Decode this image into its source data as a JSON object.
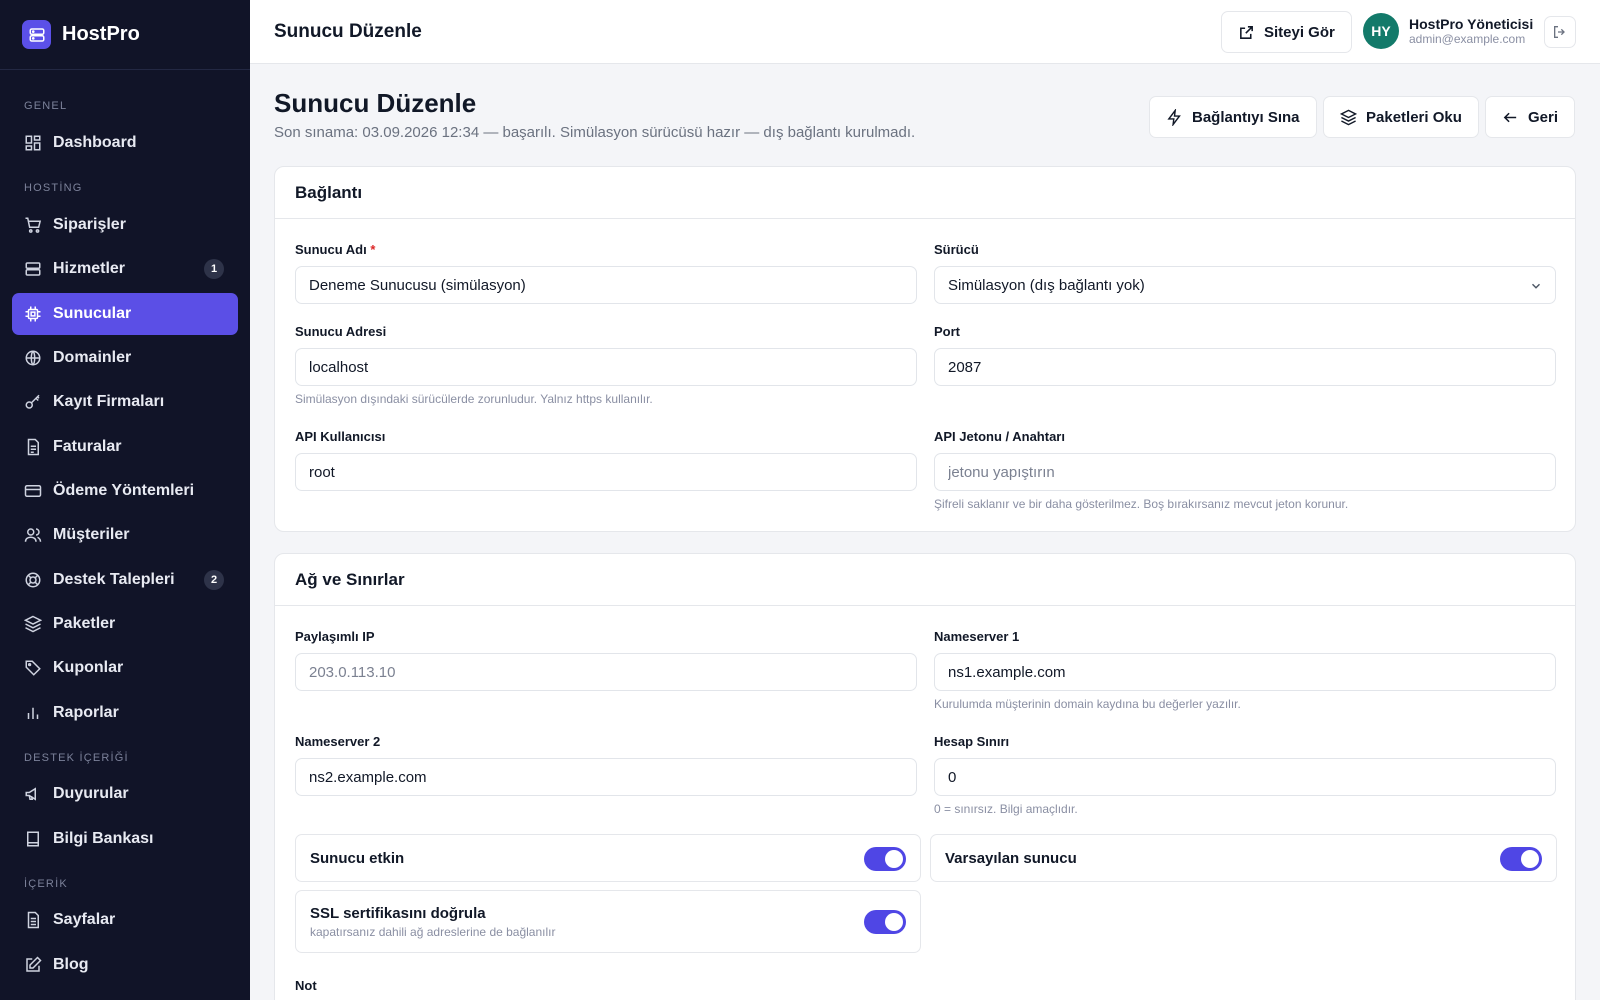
{
  "brand": {
    "name": "HostPro",
    "accent": "#5b4fe6"
  },
  "sidebar": {
    "sections": {
      "genel": "GENEL",
      "hosting": "HOSTİNG",
      "destek": "DESTEK İÇERİĞİ",
      "icerik": "İÇERİK"
    },
    "items": [
      {
        "label": "Dashboard",
        "icon": "dashboard-icon"
      },
      {
        "label": "Siparişler",
        "icon": "cart-icon"
      },
      {
        "label": "Hizmetler",
        "icon": "server-stack-icon",
        "badge": "1"
      },
      {
        "label": "Sunucular",
        "icon": "chip-icon",
        "active": true
      },
      {
        "label": "Domainler",
        "icon": "globe-icon"
      },
      {
        "label": "Kayıt Firmaları",
        "icon": "key-icon"
      },
      {
        "label": "Faturalar",
        "icon": "invoice-icon"
      },
      {
        "label": "Ödeme Yöntemleri",
        "icon": "credit-card-icon"
      },
      {
        "label": "Müşteriler",
        "icon": "users-icon"
      },
      {
        "label": "Destek Talepleri",
        "icon": "lifebuoy-icon",
        "badge": "2"
      },
      {
        "label": "Paketler",
        "icon": "layers-icon"
      },
      {
        "label": "Kuponlar",
        "icon": "tag-icon"
      },
      {
        "label": "Raporlar",
        "icon": "bar-chart-icon"
      },
      {
        "label": "Duyurular",
        "icon": "megaphone-icon"
      },
      {
        "label": "Bilgi Bankası",
        "icon": "book-icon"
      },
      {
        "label": "Sayfalar",
        "icon": "page-icon"
      },
      {
        "label": "Blog",
        "icon": "edit-icon"
      }
    ]
  },
  "topbar": {
    "title": "Sunucu Düzenle",
    "view_site": "Siteyi Gör",
    "user": {
      "initials": "HY",
      "name": "HostPro Yöneticisi",
      "email": "admin@example.com"
    }
  },
  "page": {
    "title": "Sunucu Düzenle",
    "subtitle": "Son sınama: 03.09.2026 12:34 — başarılı. Simülasyon sürücüsü hazır — dış bağlantı kurulmadı.",
    "actions": {
      "test": "Bağlantıyı Sına",
      "read_packages": "Paketleri Oku",
      "back": "Geri"
    }
  },
  "connection": {
    "title": "Bağlantı",
    "server_name": {
      "label": "Sunucu Adı",
      "required": "*",
      "value": "Deneme Sunucusu (simülasyon)"
    },
    "driver": {
      "label": "Sürücü",
      "value": "Simülasyon (dış bağlantı yok)"
    },
    "address": {
      "label": "Sunucu Adresi",
      "value": "localhost",
      "hint": "Simülasyon dışındaki sürücülerde zorunludur. Yalnız https kullanılır."
    },
    "port": {
      "label": "Port",
      "value": "2087"
    },
    "api_user": {
      "label": "API Kullanıcısı",
      "value": "root"
    },
    "api_token": {
      "label": "API Jetonu / Anahtarı",
      "placeholder": "jetonu yapıştırın",
      "hint": "Şifreli saklanır ve bir daha gösterilmez. Boş bırakırsanız mevcut jeton korunur."
    }
  },
  "network": {
    "title": "Ağ ve Sınırlar",
    "shared_ip": {
      "label": "Paylaşımlı IP",
      "placeholder": "203.0.113.10"
    },
    "ns1": {
      "label": "Nameserver 1",
      "value": "ns1.example.com",
      "hint": "Kurulumda müşterinin domain kaydına bu değerler yazılır."
    },
    "ns2": {
      "label": "Nameserver 2",
      "value": "ns2.example.com"
    },
    "account_limit": {
      "label": "Hesap Sınırı",
      "value": "0",
      "hint": "0 = sınırsız. Bilgi amaçlıdır."
    },
    "toggles": {
      "active": {
        "label": "Sunucu etkin",
        "on": true
      },
      "default": {
        "label": "Varsayılan sunucu",
        "on": true
      },
      "ssl": {
        "label": "SSL sertifikasını doğrula",
        "sub": "kapatırsanız dahili ağ adreslerine de bağlanılır",
        "on": true
      }
    },
    "note_label": "Not"
  }
}
